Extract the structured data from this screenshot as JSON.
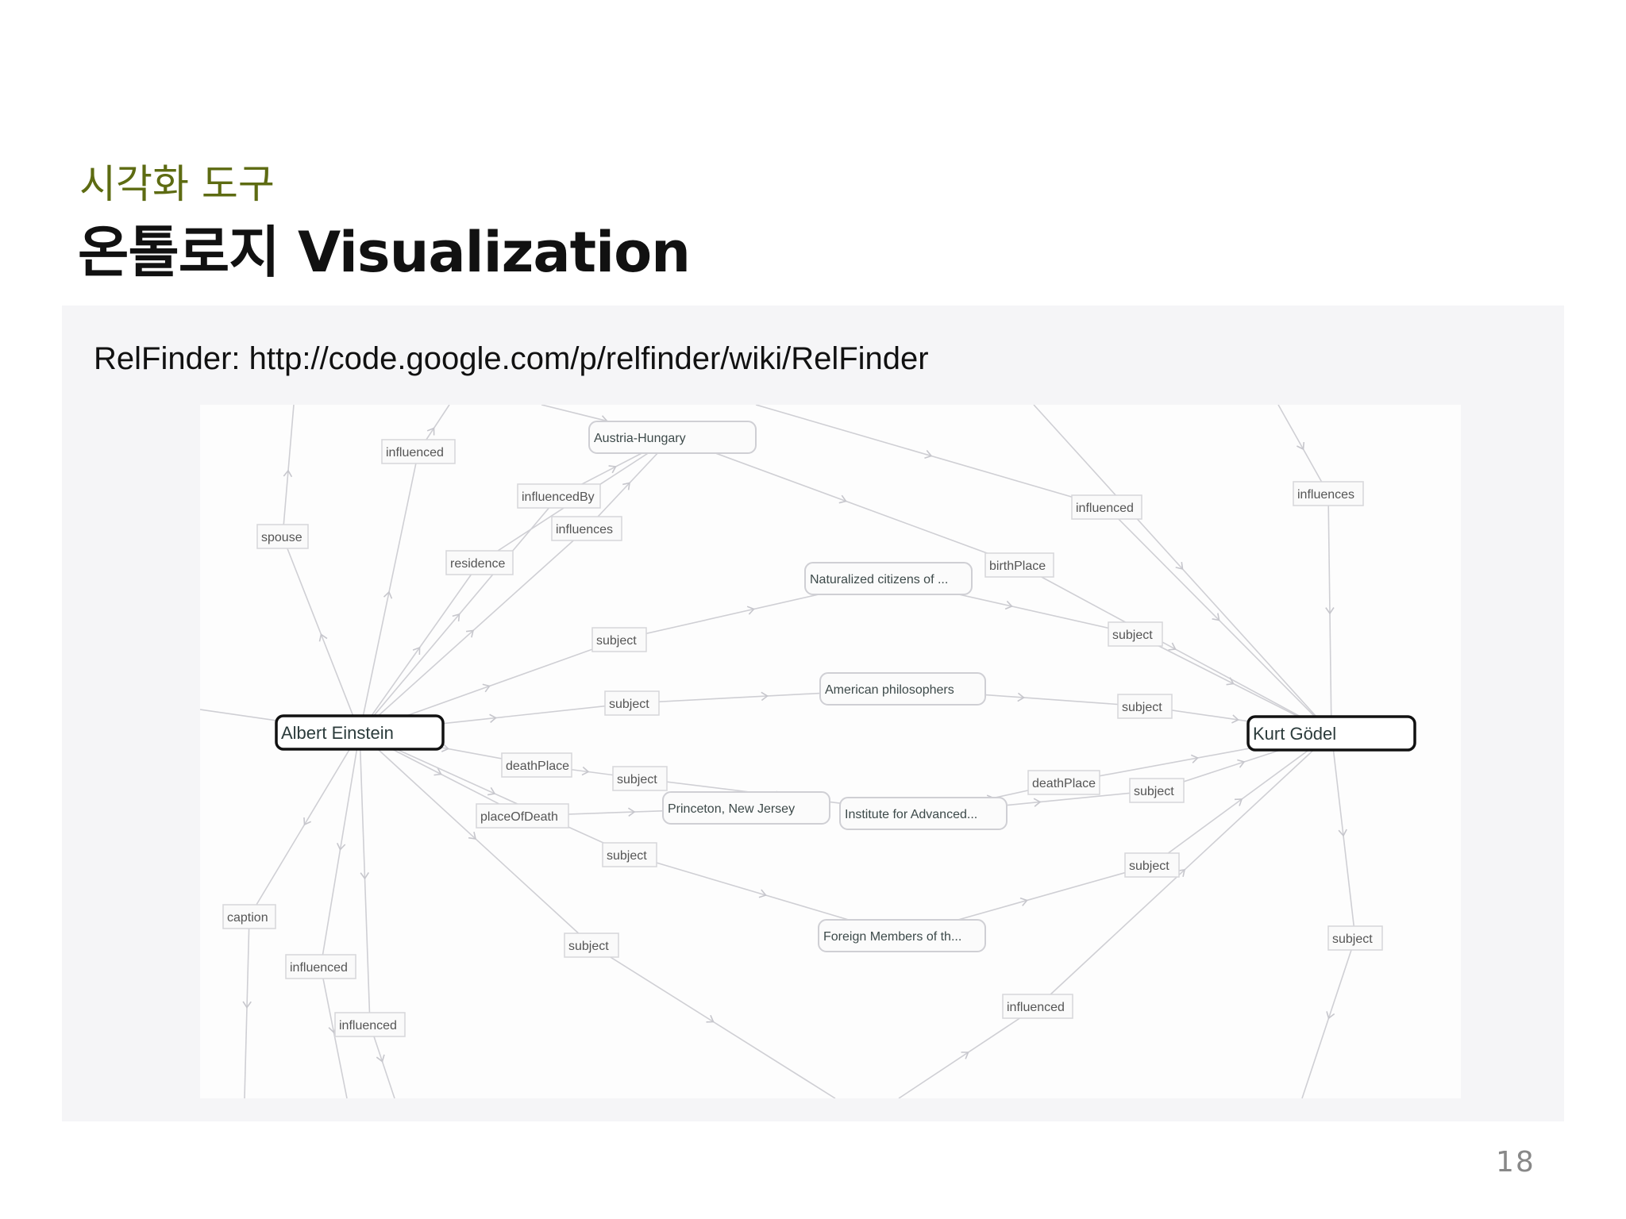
{
  "slide": {
    "subtitle": "시각화 도구",
    "title": "온톨로지 Visualization",
    "link": "RelFinder: http://code.google.com/p/relfinder/wiki/RelFinder",
    "page_number": "18"
  },
  "graph": {
    "main_nodes": [
      {
        "id": "einstein",
        "label": "Albert Einstein"
      },
      {
        "id": "godel",
        "label": "Kurt Gödel"
      }
    ],
    "class_nodes": [
      {
        "id": "austria",
        "label": "Austria-Hungary"
      },
      {
        "id": "naturalized",
        "label": "Naturalized citizens of ..."
      },
      {
        "id": "american",
        "label": "American philosophers"
      },
      {
        "id": "princeton",
        "label": "Princeton, New Jersey"
      },
      {
        "id": "institute",
        "label": "Institute for Advanced..."
      },
      {
        "id": "foreign",
        "label": "Foreign Members of th..."
      }
    ],
    "edge_labels": [
      {
        "id": "l1",
        "label": "influenced"
      },
      {
        "id": "l2",
        "label": "influencedBy"
      },
      {
        "id": "l3",
        "label": "influences"
      },
      {
        "id": "l4",
        "label": "spouse"
      },
      {
        "id": "l5",
        "label": "residence"
      },
      {
        "id": "l6",
        "label": "subject"
      },
      {
        "id": "l7",
        "label": "subject"
      },
      {
        "id": "l8",
        "label": "deathPlace"
      },
      {
        "id": "l9",
        "label": "subject"
      },
      {
        "id": "l10",
        "label": "placeOfDeath"
      },
      {
        "id": "l11",
        "label": "subject"
      },
      {
        "id": "l12",
        "label": "subject"
      },
      {
        "id": "l13",
        "label": "caption"
      },
      {
        "id": "l14",
        "label": "influenced"
      },
      {
        "id": "l15",
        "label": "influenced"
      },
      {
        "id": "l16",
        "label": "influenced"
      },
      {
        "id": "l17",
        "label": "influences"
      },
      {
        "id": "l18",
        "label": "birthPlace"
      },
      {
        "id": "l19",
        "label": "subject"
      },
      {
        "id": "l20",
        "label": "subject"
      },
      {
        "id": "l21",
        "label": "deathPlace"
      },
      {
        "id": "l22",
        "label": "subject"
      },
      {
        "id": "l23",
        "label": "subject"
      },
      {
        "id": "l24",
        "label": "influenced"
      },
      {
        "id": "l25",
        "label": "subject"
      }
    ]
  }
}
